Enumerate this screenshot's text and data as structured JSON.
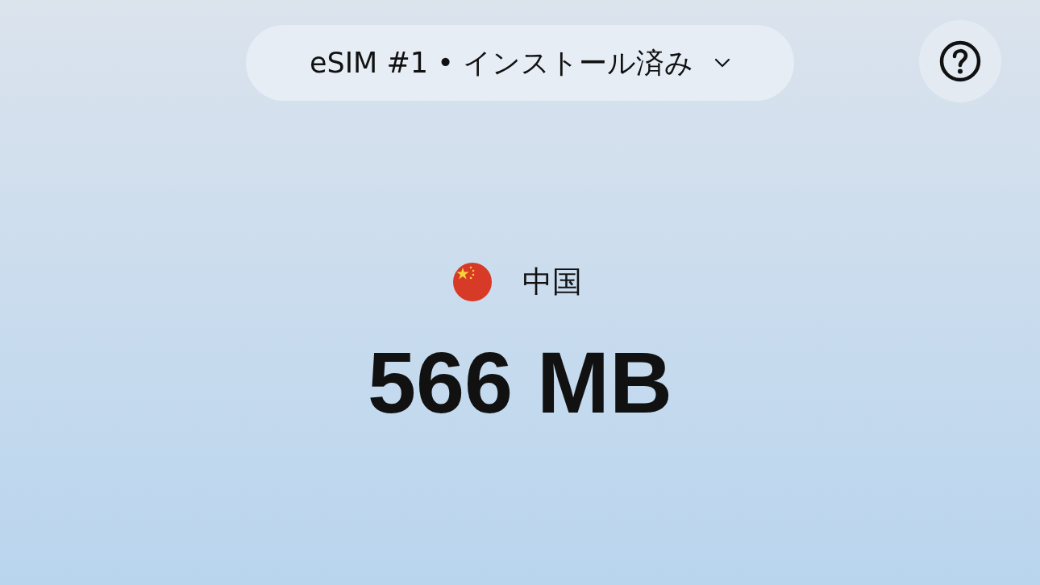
{
  "sim_selector": {
    "label": "eSIM #1 • インストール済み"
  },
  "country": {
    "name": "中国"
  },
  "data_remaining": "566 MB"
}
